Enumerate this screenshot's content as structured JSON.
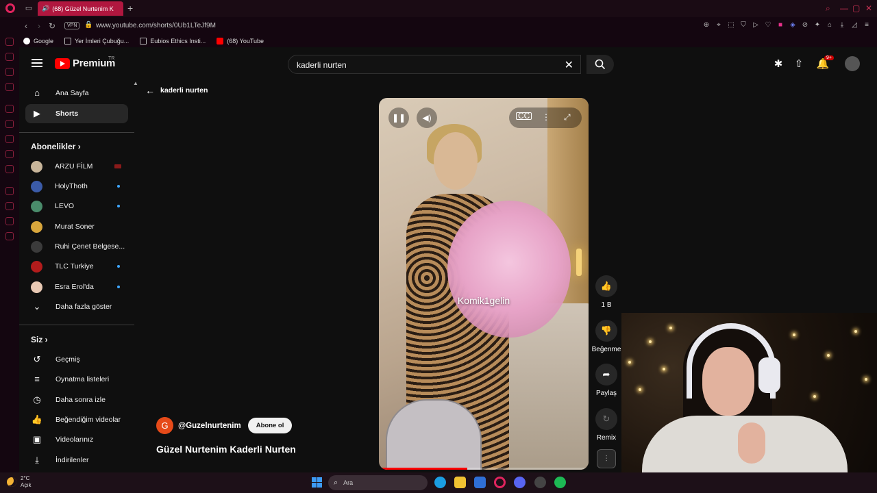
{
  "browser": {
    "tab_title": "(68) Güzel Nurtenim K",
    "url": "www.youtube.com/shorts/0Ub1LTeJf9M",
    "vpn_label": "VPN",
    "bookmarks": [
      "Google",
      "Yer İmleri Çubuğu...",
      "Eubios Ethics Insti...",
      "(68) YouTube"
    ]
  },
  "header": {
    "logo_text": "Premium",
    "region": "TR",
    "search_value": "kaderli nurten",
    "notif_count": "9+"
  },
  "sidebar": {
    "main": [
      {
        "label": "Ana Sayfa",
        "icon": "home-icon"
      },
      {
        "label": "Shorts",
        "icon": "shorts-icon"
      }
    ],
    "subs_title": "Abonelikler",
    "subs": [
      {
        "label": "ARZU FİLM",
        "color": "#c8b59a"
      },
      {
        "label": "HolyThoth",
        "color": "#3b5ba8"
      },
      {
        "label": "LEVO",
        "color": "#4a8c6b"
      },
      {
        "label": "Murat Soner",
        "color": "#d8a63c"
      },
      {
        "label": "Ruhi Çenet Belgese...",
        "color": "#3b3b3b"
      },
      {
        "label": "TLC Turkiye",
        "color": "#b31c1c"
      },
      {
        "label": "Esra Erol'da",
        "color": "#e9c9b4"
      }
    ],
    "show_more": "Daha fazla göster",
    "you_title": "Siz",
    "you": [
      {
        "label": "Geçmiş",
        "icon": "history-icon"
      },
      {
        "label": "Oynatma listeleri",
        "icon": "playlist-icon"
      },
      {
        "label": "Daha sonra izle",
        "icon": "clock-icon"
      },
      {
        "label": "Beğendiğim videolar",
        "icon": "thumbs-up-icon"
      },
      {
        "label": "Videolarınız",
        "icon": "video-icon"
      },
      {
        "label": "İndirilenler",
        "icon": "download-icon"
      }
    ]
  },
  "back": {
    "label": "kaderli nurten"
  },
  "short": {
    "watermark": "Komik1gelin",
    "channel_initial": "G",
    "channel_handle": "@Guzelnurtenim",
    "subscribe_label": "Abone ol",
    "title": "Güzel Nurtenim Kaderli Nurten",
    "progress": 0.42
  },
  "actions": {
    "like_count": "1 B",
    "dislike_label": "Beğenme",
    "share_label": "Paylaş",
    "remix_label": "Remix"
  },
  "taskbar": {
    "temperature": "2°C",
    "condition": "Açık",
    "search_label": "Ara"
  }
}
